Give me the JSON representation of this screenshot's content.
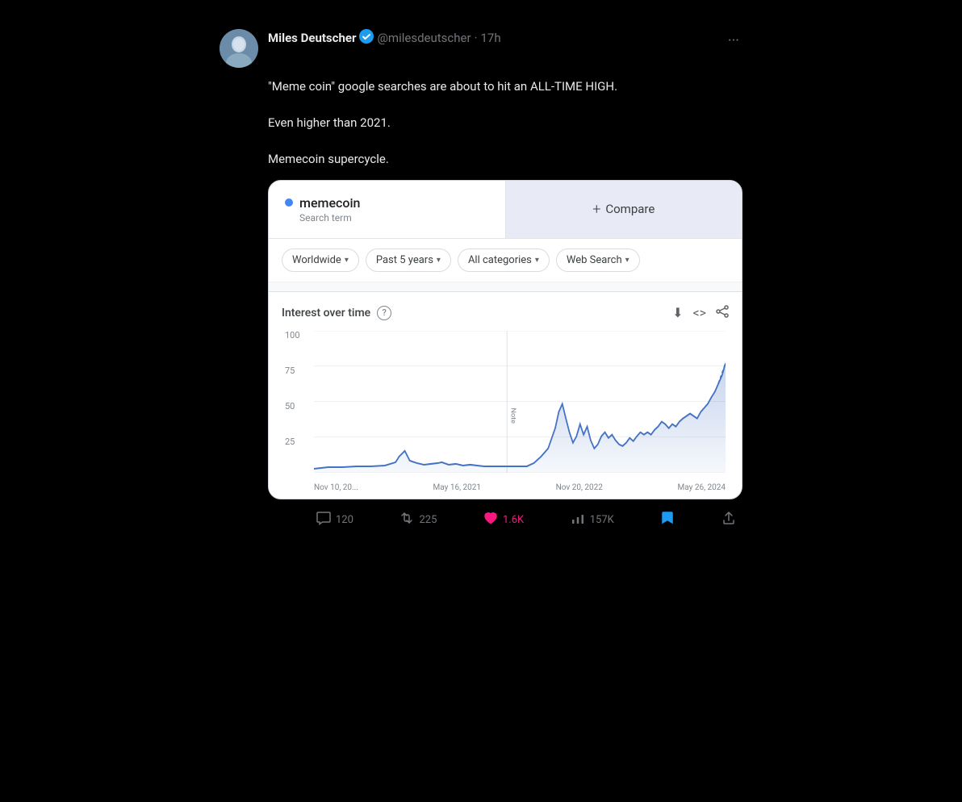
{
  "tweet": {
    "user": {
      "name": "Miles Deutscher",
      "handle": "@milesdeutscher",
      "time": "17h",
      "verified": true,
      "avatar_emoji": "👤"
    },
    "text": "\"Meme coin\" google searches are about to hit an ALL-TIME HIGH.\n\nEven higher than 2021.\n\nMemecoin supercycle.",
    "more_label": "···",
    "actions": {
      "reply_count": "120",
      "retweet_count": "225",
      "like_count": "1.6K",
      "views_count": "157K"
    }
  },
  "trends_card": {
    "search_term": "memecoin",
    "search_term_label": "Search term",
    "compare_label": "Compare",
    "compare_plus": "+",
    "filters": [
      {
        "label": "Worldwide"
      },
      {
        "label": "Past 5 years"
      },
      {
        "label": "All categories"
      },
      {
        "label": "Web Search"
      }
    ],
    "chart": {
      "title": "Interest over time",
      "y_labels": [
        "100",
        "75",
        "50",
        "25"
      ],
      "x_labels": [
        "Nov 10, 20...",
        "May 16, 2021",
        "Nov 20, 2022",
        "May 26, 2024"
      ],
      "note_label": "Note"
    }
  },
  "icons": {
    "verified": "✓",
    "reply": "💬",
    "retweet": "🔁",
    "like": "❤",
    "views": "📊",
    "bookmark": "🔖",
    "share": "↑",
    "download": "↓",
    "embed": "<>",
    "share_chart": "↗",
    "question": "?"
  },
  "colors": {
    "background": "#000000",
    "card_bg": "#ffffff",
    "accent_blue": "#4285f4",
    "compare_bg": "#e8eaf6",
    "chart_line": "#4472c4",
    "text_primary": "#e7e9ea",
    "text_secondary": "#71767b"
  }
}
